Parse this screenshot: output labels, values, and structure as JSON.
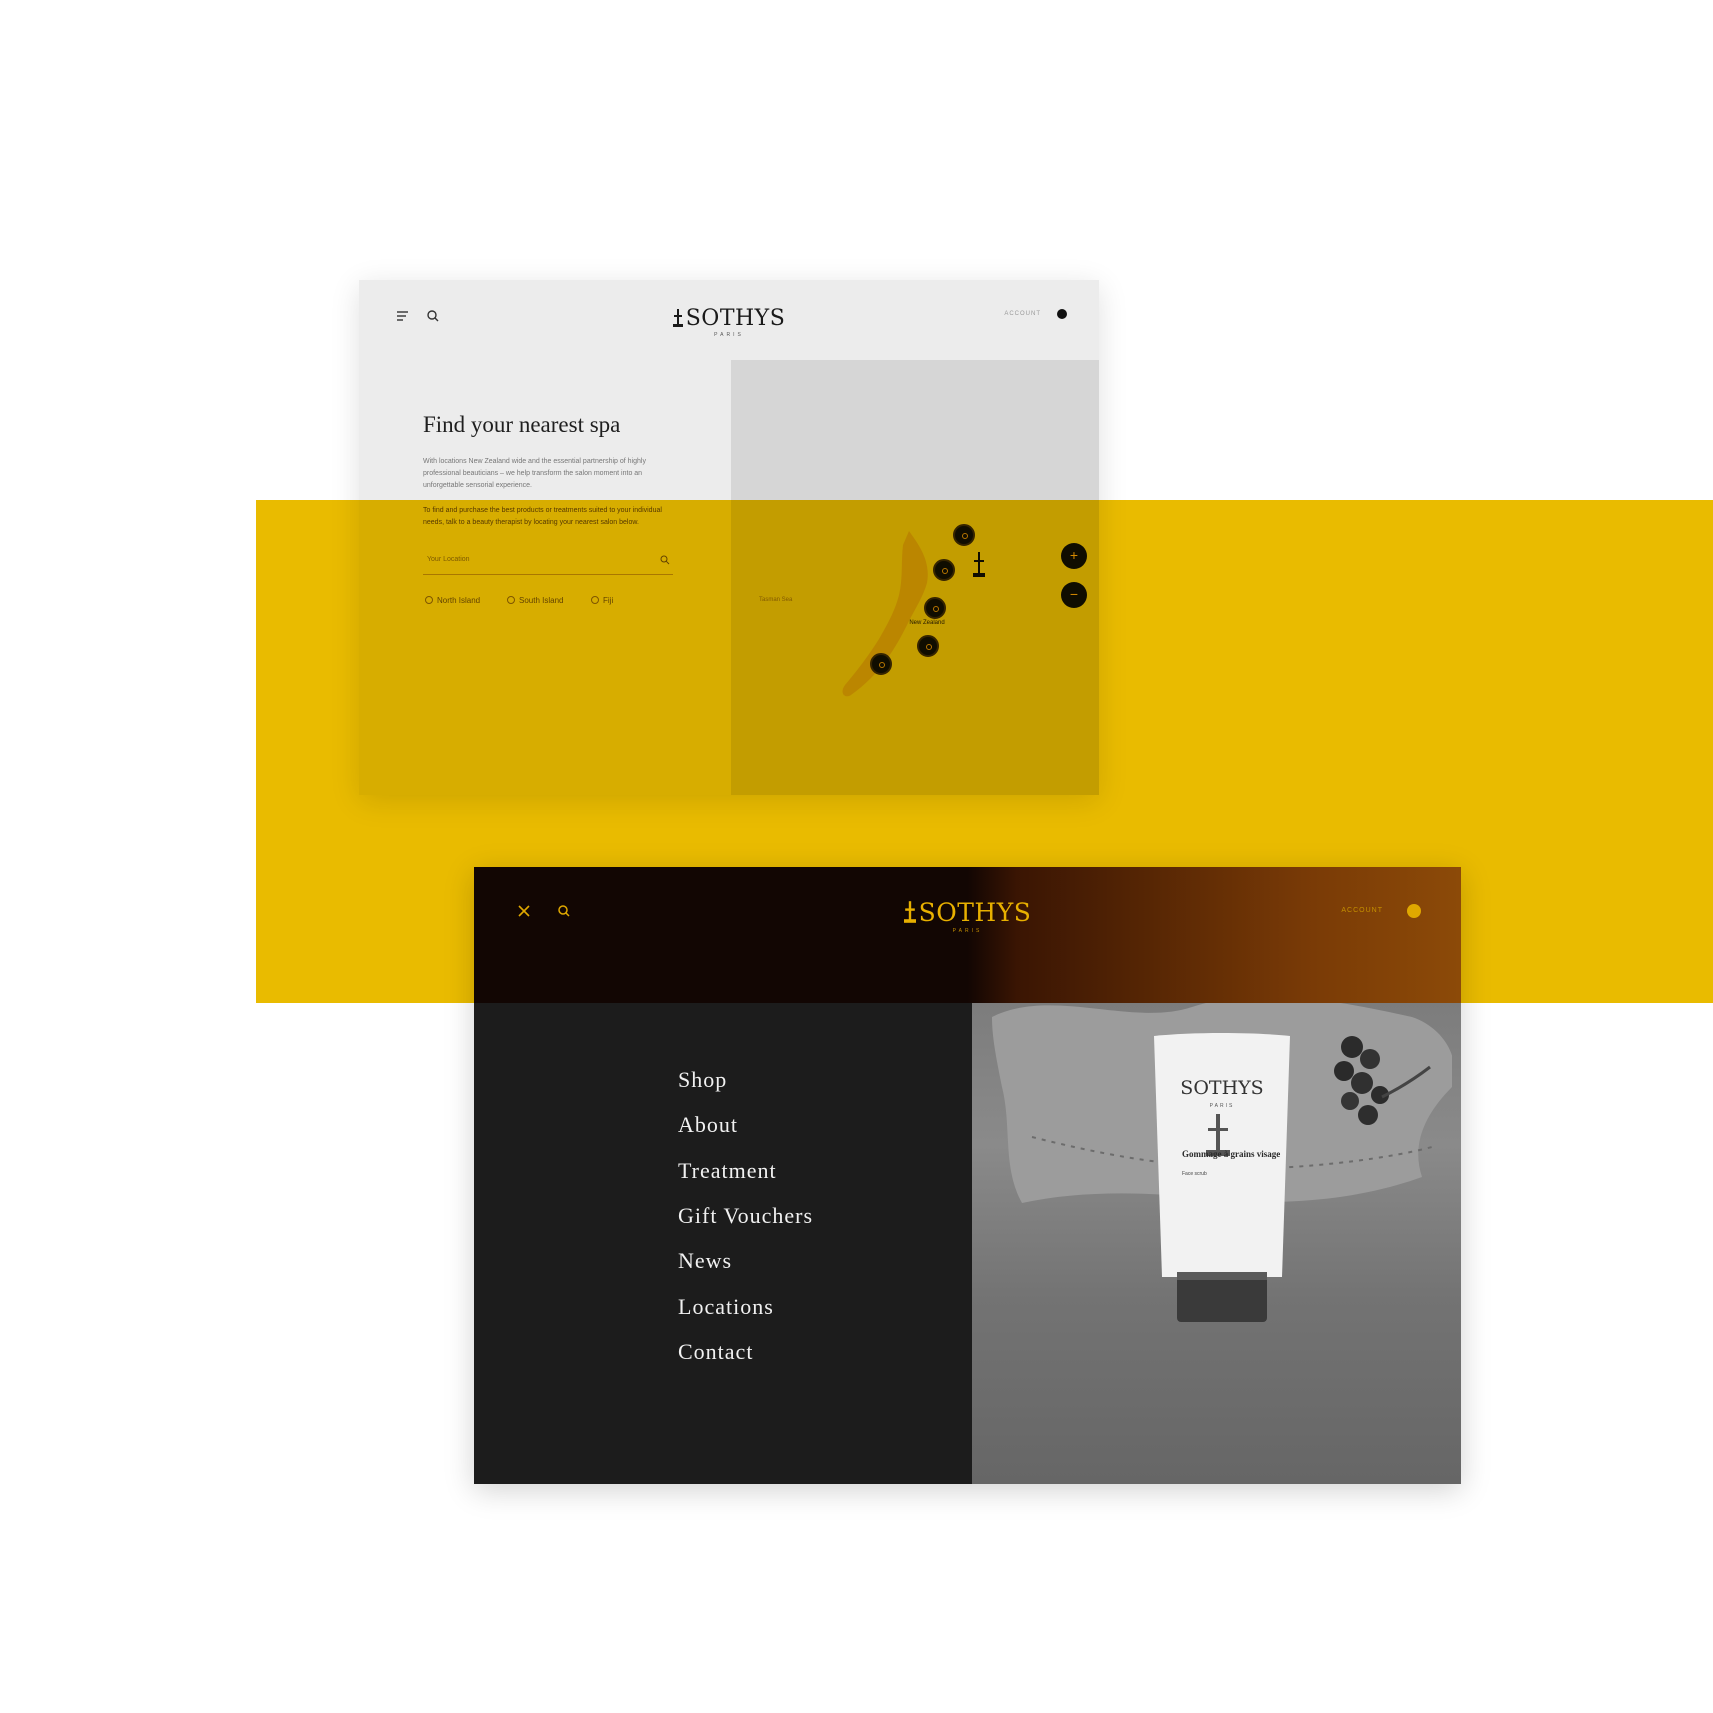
{
  "card1": {
    "brand": "SOTHYS",
    "brand_sub": "PARIS",
    "account_label": "ACCOUNT",
    "title": "Find your nearest spa",
    "paragraph1": "With locations New Zealand wide and the essential partnership of highly professional beauticians – we help transform the salon moment into an unforgettable sensorial experience.",
    "paragraph2": "To find and purchase the best products or treatments suited to your individual needs, talk to a beauty therapist by locating your nearest salon below.",
    "search_placeholder": "Your Location",
    "regions": [
      "North Island",
      "South Island",
      "Fiji"
    ],
    "map": {
      "country_label": "New Zealand",
      "sea_label": "Tasman Sea",
      "zoom_in": "+",
      "zoom_out": "−"
    }
  },
  "card2": {
    "brand": "SOTHYS",
    "brand_sub": "PARIS",
    "account_label": "ACCOUNT",
    "menu": [
      "Shop",
      "About",
      "Treatment",
      "Gift Vouchers",
      "News",
      "Locations",
      "Contact"
    ],
    "product": {
      "brand": "SOTHYS",
      "brand_sub": "PARIS",
      "name": "Gommage à grains visage",
      "desc": "Face scrub"
    }
  },
  "colors": {
    "accent_yellow": "#e9bb00",
    "dark_panel": "#1c1c1c",
    "light_card": "#ececec"
  },
  "icons": {
    "card1": [
      "menu-icon",
      "search-icon",
      "account-dot-icon"
    ],
    "card2": [
      "close-icon",
      "search-icon",
      "account-dot-icon"
    ]
  }
}
